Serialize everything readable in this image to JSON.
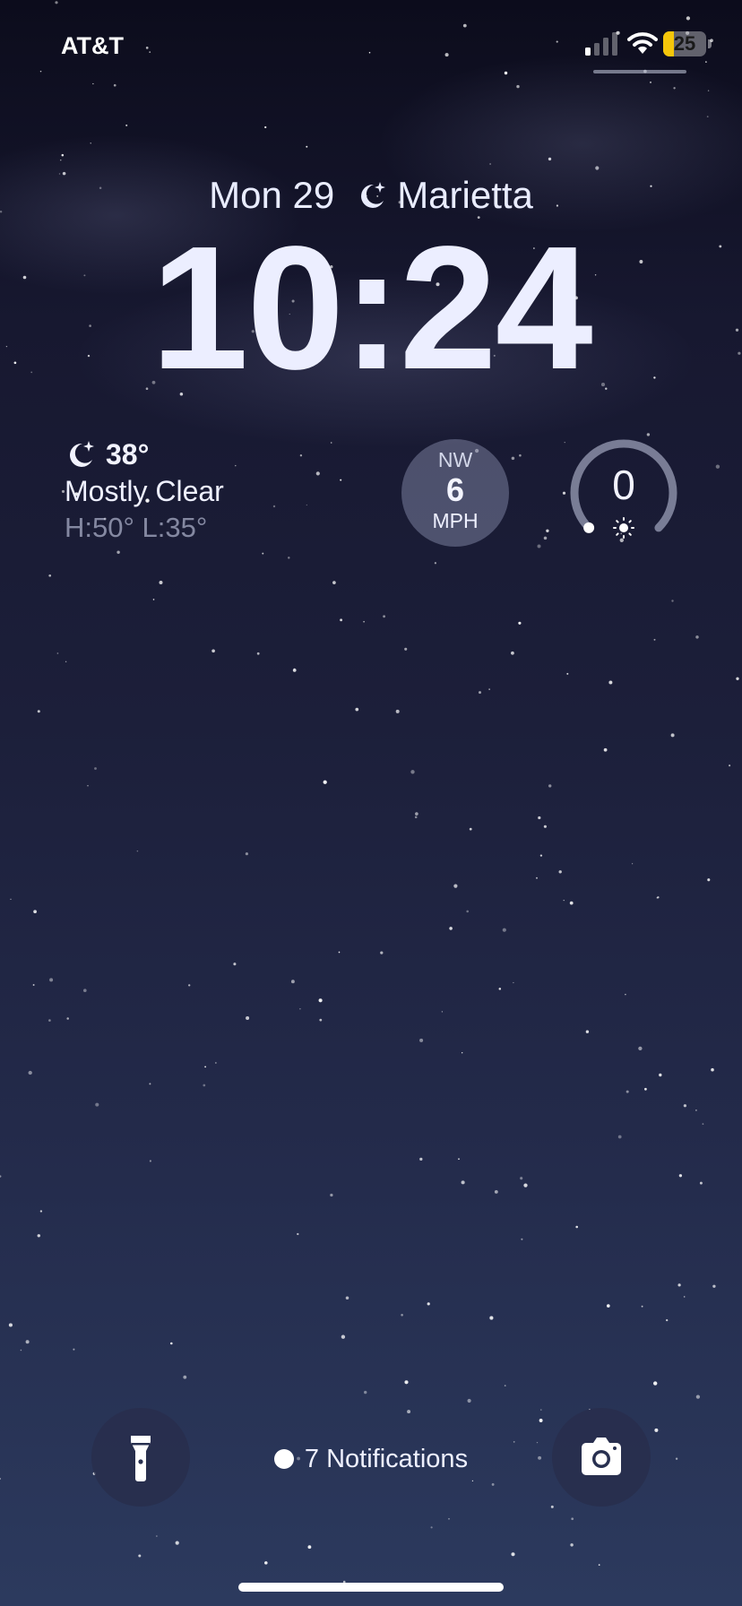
{
  "status_bar": {
    "carrier": "AT&T",
    "signal_icon": "cellular-signal-icon",
    "wifi_icon": "wifi-icon",
    "battery_percent": 25,
    "battery_label": "25",
    "battery_color": "#f5c60a"
  },
  "lock_screen": {
    "date": "Mon 29",
    "location_icon": "moon-icon",
    "location": "Marietta",
    "time": "10:24"
  },
  "widgets": {
    "weather": {
      "icon": "moon-stars-icon",
      "temperature": "38°",
      "condition": "Mostly Clear",
      "high_low": "H:50° L:35°"
    },
    "wind": {
      "direction": "NW",
      "speed": "6",
      "unit": "MPH"
    },
    "uv_index": {
      "value": "0",
      "icon": "sun-icon",
      "level_fraction": 0
    }
  },
  "bottom": {
    "flashlight_icon": "flashlight-icon",
    "camera_icon": "camera-icon",
    "notifications_label": "7 Notifications"
  }
}
